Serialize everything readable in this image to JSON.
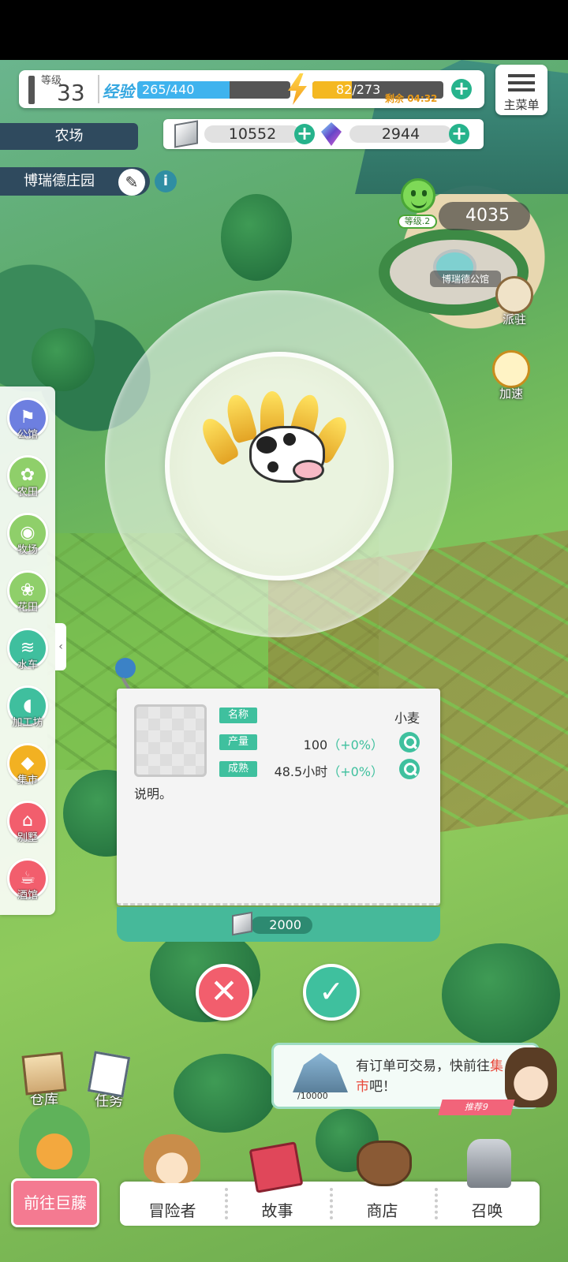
{
  "player": {
    "level_label": "等级",
    "level": "33",
    "exp_label": "经验",
    "exp_text": "265/440",
    "exp_ratio": 0.602,
    "energy_text": "82/273",
    "energy_ratio": 0.3,
    "timer_label": "剩余",
    "timer_value": "04:32"
  },
  "menu": {
    "label": "主菜单"
  },
  "location": {
    "region": "农场",
    "manor_name": "博瑞德庄园"
  },
  "currency": {
    "stone": "10552",
    "crystal": "2944"
  },
  "building": {
    "level_label": "等级.2",
    "popularity": "4035",
    "fountain_label": "博瑞德公馆"
  },
  "right_actions": [
    {
      "label": "派驻",
      "icon": "pin-map-icon"
    },
    {
      "label": "加速",
      "icon": "stopwatch-icon"
    }
  ],
  "sidebar": {
    "items": [
      {
        "label": "公馆",
        "icon": "flag-icon",
        "color": "#6d7fe0"
      },
      {
        "label": "农田",
        "icon": "wheat-icon",
        "color": "#8fcf6a"
      },
      {
        "label": "牧场",
        "icon": "cow-icon",
        "color": "#8fcf6a"
      },
      {
        "label": "花田",
        "icon": "flower-icon",
        "color": "#8fcf6a"
      },
      {
        "label": "水车",
        "icon": "waterwheel-icon",
        "color": "#3fbf9e"
      },
      {
        "label": "加工坊",
        "icon": "bread-icon",
        "color": "#3fbf9e"
      },
      {
        "label": "集市",
        "icon": "market-icon",
        "color": "#f2b122"
      },
      {
        "label": "别墅",
        "icon": "villa-icon",
        "color": "#f25e6d"
      },
      {
        "label": "酒馆",
        "icon": "tavern-icon",
        "color": "#f25e6d"
      }
    ],
    "collapse_glyph": "‹"
  },
  "item_card": {
    "name_tag": "名称",
    "name_value": "小麦",
    "yield_tag": "产量",
    "yield_value": "100",
    "yield_bonus": "（+0%）",
    "mature_tag": "成熟",
    "mature_value": "48.5小时",
    "mature_bonus": "（+0%）",
    "description": "说明。",
    "cost": "2000"
  },
  "confirm": {
    "cancel_glyph": "✕",
    "ok_glyph": "✓"
  },
  "notice": {
    "count": "/10000",
    "msg_part1": "有订单可交易，快前往",
    "msg_highlight": "集市",
    "msg_part2": "吧！",
    "recommend": "推荐9"
  },
  "quick_buttons": [
    {
      "label": "仓库",
      "icon": "warehouse-icon"
    },
    {
      "label": "任务",
      "icon": "quest-icon"
    }
  ],
  "bottom_nav": {
    "giant_label": "前往巨藤",
    "items": [
      {
        "label": "冒险者",
        "icon": "adventurer-icon"
      },
      {
        "label": "故事",
        "icon": "story-book-icon"
      },
      {
        "label": "商店",
        "icon": "shop-bag-icon"
      },
      {
        "label": "召唤",
        "icon": "summon-icon"
      }
    ]
  },
  "colors": {
    "accent": "#3fc09e",
    "danger": "#f25e6d",
    "exp": "#3fb3ee",
    "energy": "#f4b821",
    "panel_dark": "#2f4a5e"
  }
}
